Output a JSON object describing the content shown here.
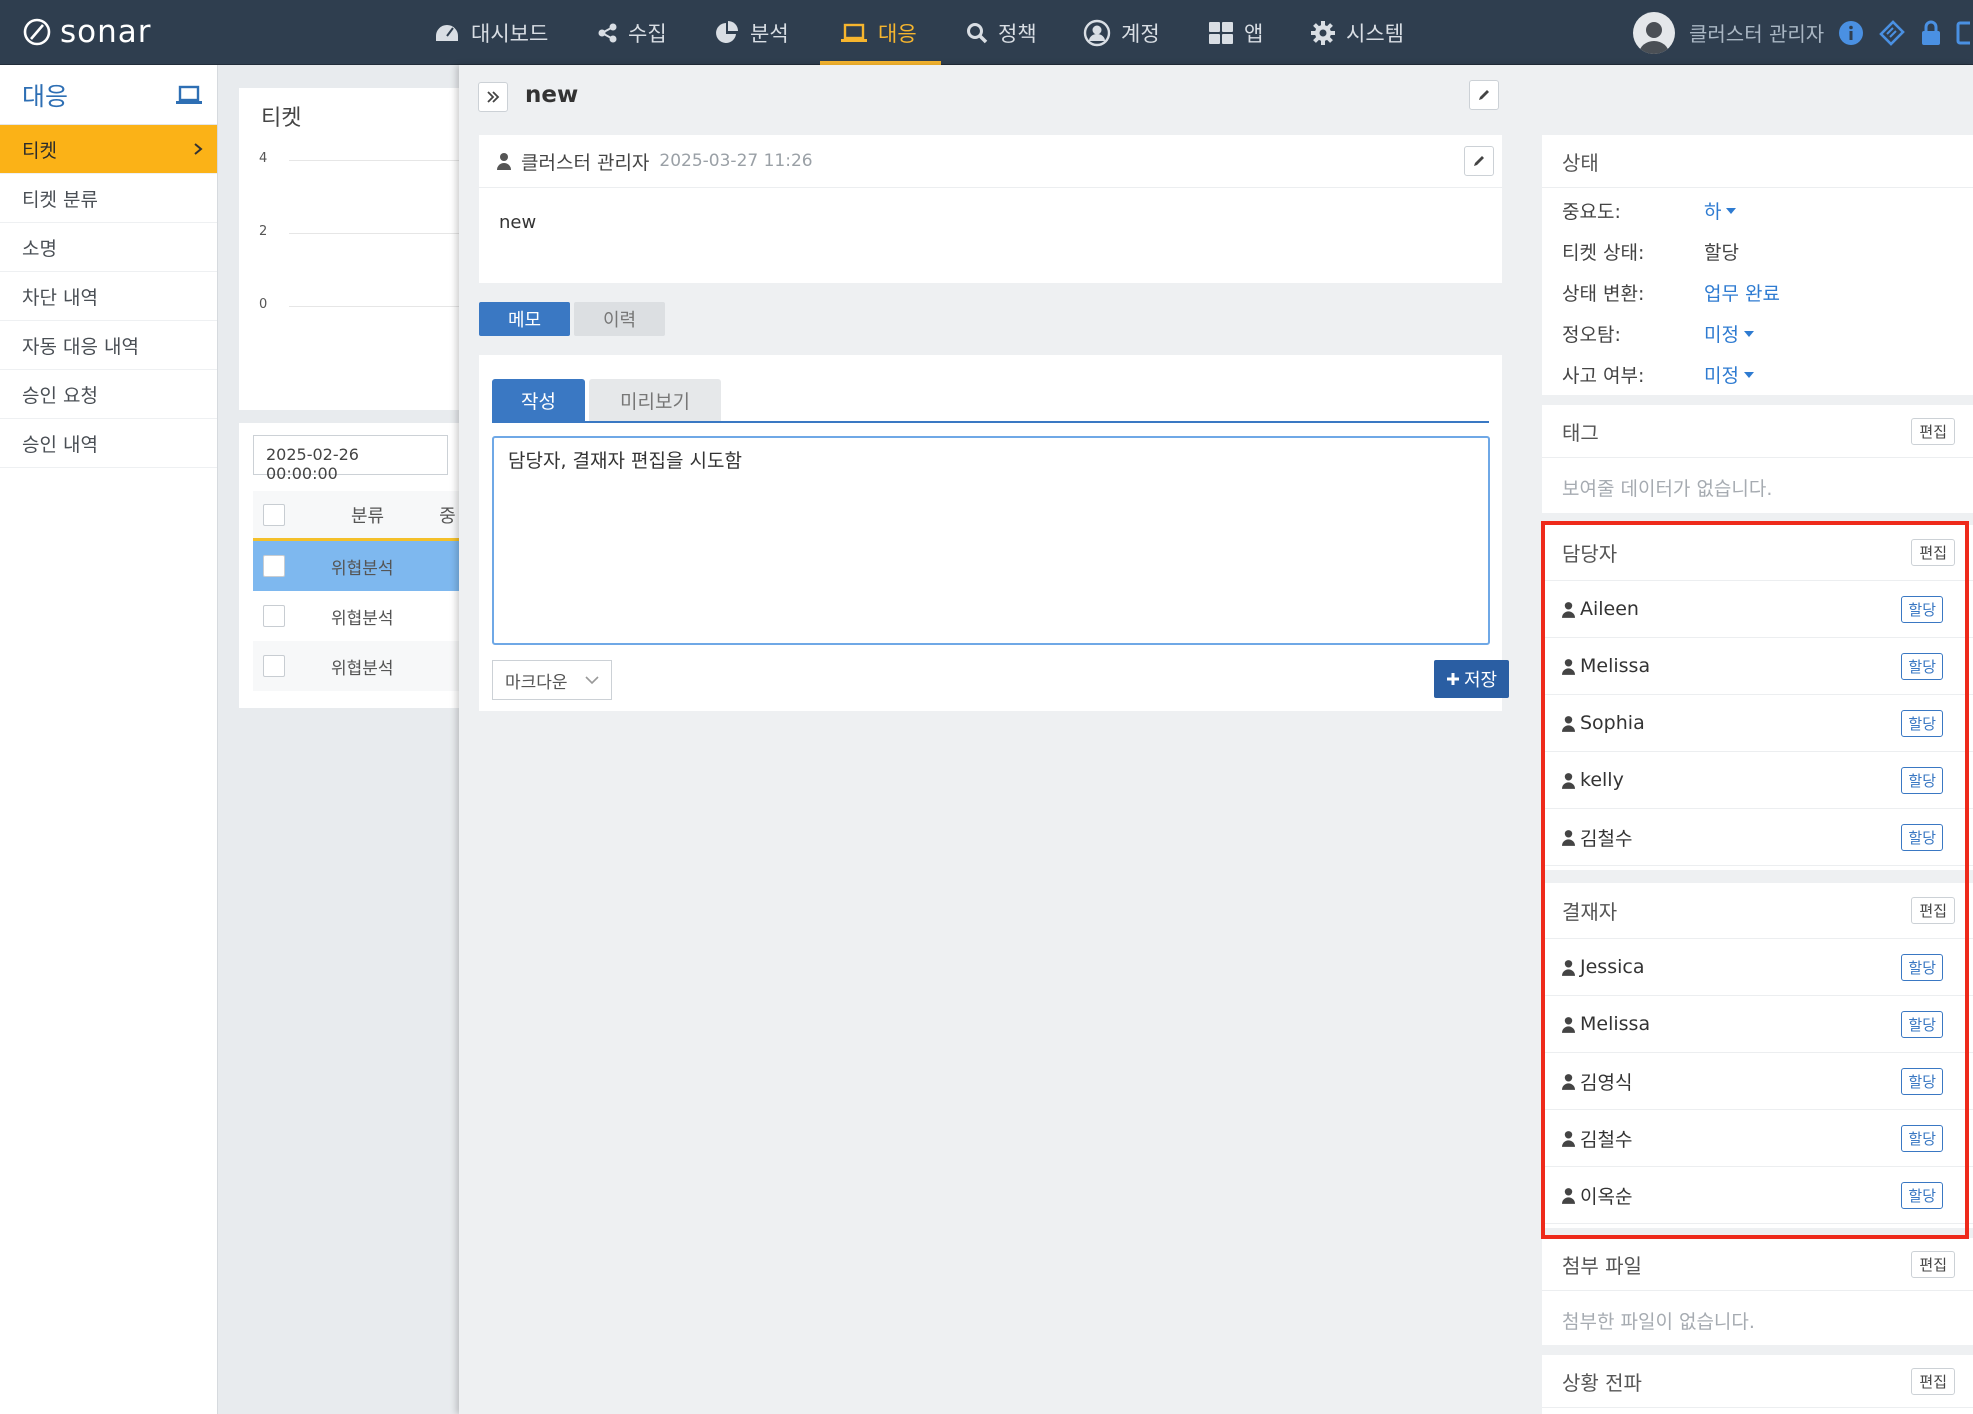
{
  "app": {
    "logo_text": "sonar"
  },
  "nav": {
    "items": [
      {
        "label": "대시보드",
        "icon": "dashboard-icon"
      },
      {
        "label": "수집",
        "icon": "share-icon"
      },
      {
        "label": "분석",
        "icon": "pie-chart-icon"
      },
      {
        "label": "대응",
        "icon": "laptop-icon",
        "active": true
      },
      {
        "label": "정책",
        "icon": "search-icon"
      },
      {
        "label": "계정",
        "icon": "user-circle-icon"
      },
      {
        "label": "앱",
        "icon": "grid-icon"
      },
      {
        "label": "시스템",
        "icon": "gear-icon"
      }
    ],
    "user_name": "클러스터 관리자"
  },
  "sidebar": {
    "title": "대응",
    "items": [
      {
        "label": "티켓",
        "active": true
      },
      {
        "label": "티켓 분류"
      },
      {
        "label": "소명"
      },
      {
        "label": "차단 내역"
      },
      {
        "label": "자동 대응 내역"
      },
      {
        "label": "승인 요청"
      },
      {
        "label": "승인 내역"
      }
    ]
  },
  "ticket_list": {
    "title": "티켓",
    "y_ticks": [
      "4",
      "2",
      "0"
    ],
    "date_from": "2025-02-26 00:00:00",
    "col_category": "분류",
    "col_partial": "중",
    "rows": [
      "위협분석",
      "위협분석",
      "위협분석"
    ]
  },
  "detail": {
    "title": "new",
    "comment": {
      "author": "클러스터 관리자",
      "date": "2025-03-27 11:26",
      "body": "new"
    },
    "tabs": {
      "memo": "메모",
      "history": "이력"
    },
    "editor_tabs": {
      "write": "작성",
      "preview": "미리보기"
    },
    "memo_text": "담당자, 결재자 편집을 시도함",
    "format_select": "마크다운",
    "save_label": "저장"
  },
  "status_panel": {
    "title": "상태",
    "importance_label": "중요도:",
    "importance_value": "하",
    "ticket_status_label": "티켓 상태:",
    "ticket_status_value": "할당",
    "status_change_label": "상태 변환:",
    "status_change_value": "업무 완료",
    "false_positive_label": "정오탐:",
    "false_positive_value": "미정",
    "incident_label": "사고 여부:",
    "incident_value": "미정"
  },
  "tag_panel": {
    "title": "태그",
    "edit_label": "편집",
    "empty": "보여줄 데이터가 없습니다."
  },
  "assignee_panel": {
    "title": "담당자",
    "edit_label": "편집",
    "assign_label": "할당",
    "people": [
      "Aileen",
      "Melissa",
      "Sophia",
      "kelly",
      "김철수"
    ]
  },
  "approver_panel": {
    "title": "결재자",
    "edit_label": "편집",
    "assign_label": "할당",
    "people": [
      "Jessica",
      "Melissa",
      "김영식",
      "김철수",
      "이옥순"
    ]
  },
  "attachment_panel": {
    "title": "첨부 파일",
    "edit_label": "편집",
    "empty": "첨부한 파일이 없습니다."
  },
  "propagation_panel": {
    "title": "상황 전파",
    "edit_label": "편집"
  },
  "colors": {
    "nav_bg": "#2f3e4f",
    "accent": "#f6b52e",
    "primary": "#3a78c3",
    "highlight": "#ee2a1b"
  }
}
